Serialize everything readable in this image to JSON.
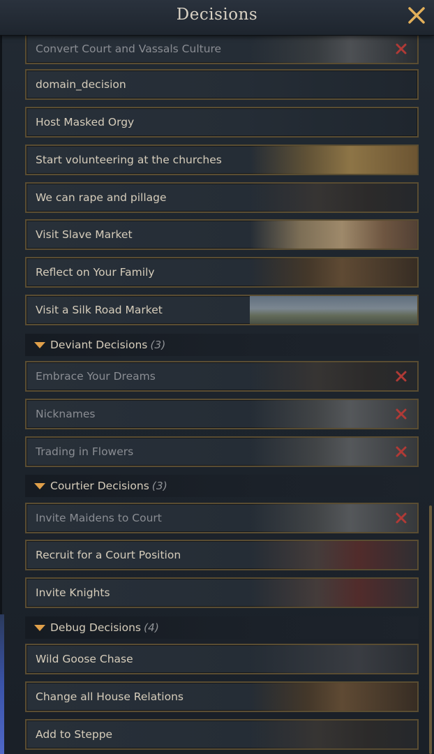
{
  "window": {
    "title": "Decisions",
    "close_icon": "close-icon"
  },
  "colors": {
    "accent_gold": "#e0a04a",
    "border_gold": "#5a4d32",
    "disabled_x_red": "#b03a36",
    "text_primary": "#d6cdbb",
    "text_disabled": "#8a8d93"
  },
  "top_items": [
    {
      "label": "Convert Court and Vassals Culture",
      "disabled": true
    },
    {
      "label": "domain_decision",
      "disabled": false
    },
    {
      "label": "Host Masked Orgy",
      "disabled": false
    },
    {
      "label": "Start volunteering at the churches",
      "disabled": false
    },
    {
      "label": "We can rape and pillage",
      "disabled": false
    },
    {
      "label": "Visit Slave Market",
      "disabled": false
    },
    {
      "label": "Reflect on Your Family",
      "disabled": false
    },
    {
      "label": "Visit a Silk Road Market",
      "disabled": false
    }
  ],
  "groups": [
    {
      "name": "Deviant Decisions",
      "count": "(3)",
      "items": [
        {
          "label": "Embrace Your Dreams",
          "disabled": true
        },
        {
          "label": "Nicknames",
          "disabled": true
        },
        {
          "label": "Trading in Flowers",
          "disabled": true
        }
      ]
    },
    {
      "name": "Courtier Decisions",
      "count": "(3)",
      "items": [
        {
          "label": "Invite Maidens to Court",
          "disabled": true
        },
        {
          "label": "Recruit for a Court Position",
          "disabled": false
        },
        {
          "label": "Invite Knights",
          "disabled": false
        }
      ]
    },
    {
      "name": "Debug Decisions",
      "count": "(4)",
      "items": [
        {
          "label": "Wild Goose Chase",
          "disabled": false
        },
        {
          "label": "Change all House Relations",
          "disabled": false
        },
        {
          "label": "Add to Steppe",
          "disabled": false
        }
      ]
    }
  ]
}
